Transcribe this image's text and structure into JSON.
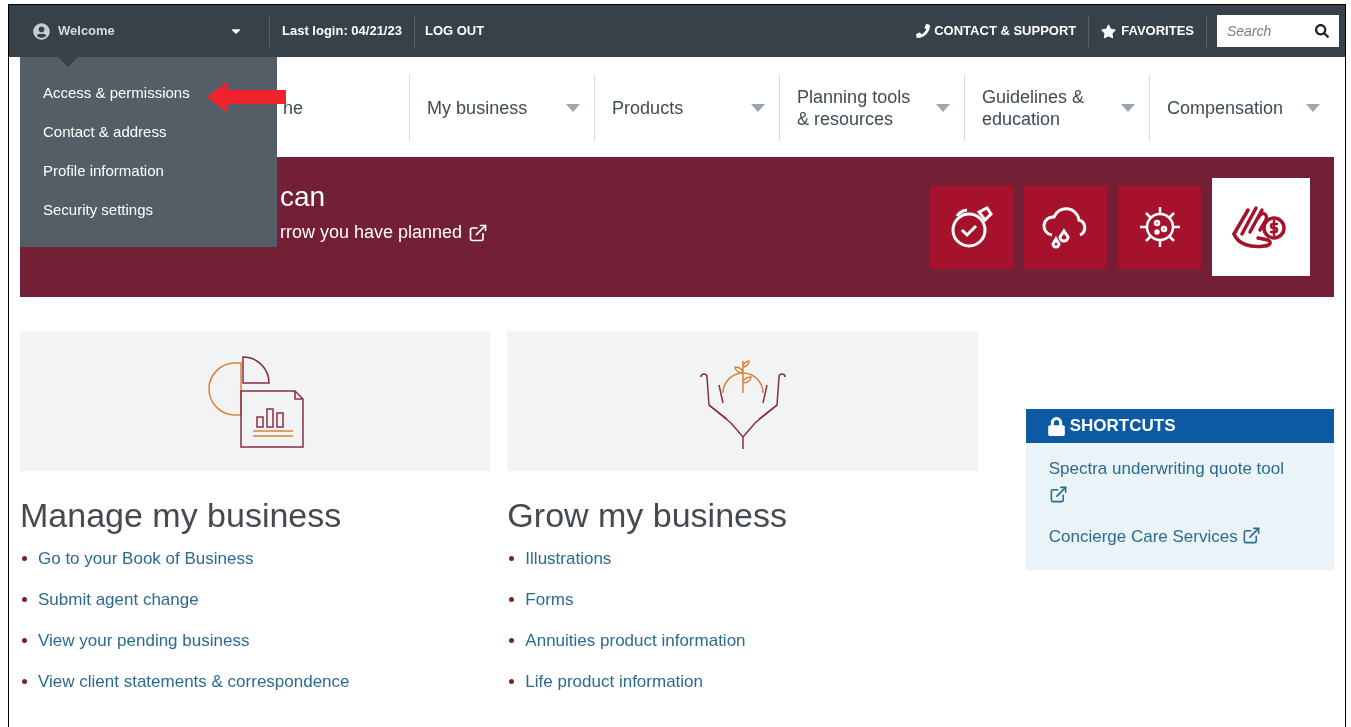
{
  "top_bar": {
    "user_menu": {
      "label": "Welcome",
      "expanded": true
    },
    "last_login": "Last login: 04/21/23",
    "logout": "LOG OUT",
    "contact": "CONTACT & SUPPORT",
    "favorites": "FAVORITES",
    "search": {
      "placeholder": "Search"
    }
  },
  "user_menu_items": [
    "Access & permissions",
    "Contact & address",
    "Profile information",
    "Security settings"
  ],
  "nav": [
    {
      "label": "ne",
      "caret": false
    },
    {
      "label": "My business",
      "caret": true
    },
    {
      "label": "Products",
      "caret": true
    },
    {
      "label": "Planning tools & resources",
      "caret": true
    },
    {
      "label": "Guidelines & education",
      "caret": true
    },
    {
      "label": "Compensation",
      "caret": true
    }
  ],
  "banner": {
    "heading": "can",
    "link": "rrow you have planned",
    "tiles": [
      {
        "kind": "stopwatch",
        "selected": false
      },
      {
        "kind": "storm",
        "selected": false
      },
      {
        "kind": "virus",
        "selected": false
      },
      {
        "kind": "hand-money",
        "selected": true
      }
    ]
  },
  "sections": [
    {
      "kind": "chart-document",
      "title": "Manage my business",
      "links": [
        "Go to your Book of Business",
        "Submit agent change",
        "View your pending business",
        "View client statements & correspondence"
      ]
    },
    {
      "kind": "hands-sprout",
      "title": "Grow my business",
      "links": [
        "Illustrations",
        "Forms",
        "Annuities product information",
        "Life product information"
      ]
    }
  ],
  "shortcuts": {
    "title": "SHORTCUTS",
    "links": [
      "Spectra underwriting quote tool",
      "Concierge Care Services"
    ]
  }
}
